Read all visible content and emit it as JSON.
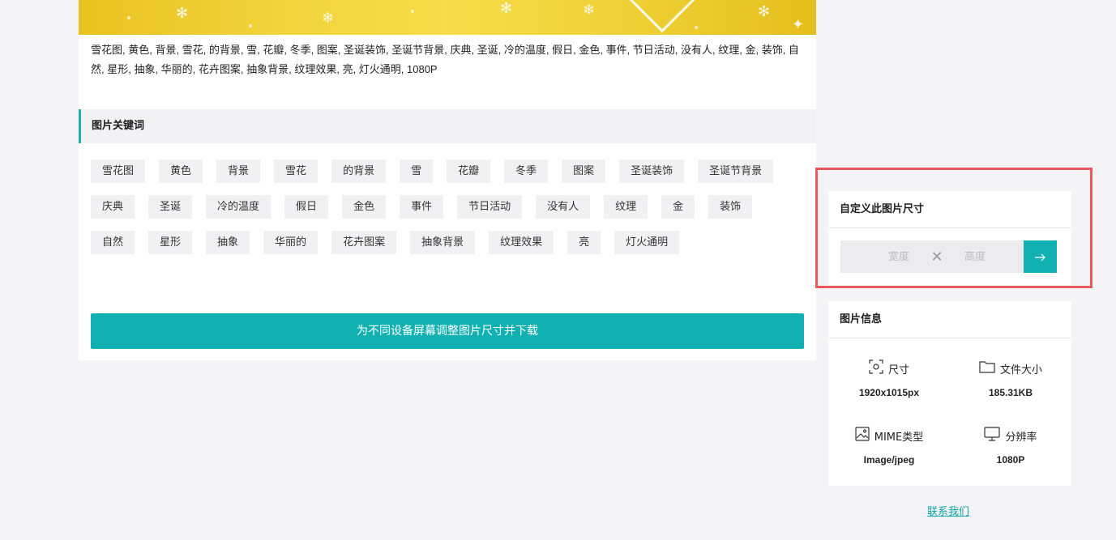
{
  "description": "雪花图, 黄色, 背景, 雪花, 的背景, 雪, 花瓣, 冬季, 图案, 圣诞装饰, 圣诞节背景, 庆典, 圣诞, 冷的温度, 假日, 金色, 事件, 节日活动, 没有人, 纹理, 金, 装饰, 自然, 星形, 抽象, 华丽的, 花卉图案, 抽象背景, 纹理效果, 亮, 灯火通明, 1080P",
  "keywords": {
    "title": "图片关键词",
    "tags": [
      "雪花图",
      "黄色",
      "背景",
      "雪花",
      "的背景",
      "雪",
      "花瓣",
      "冬季",
      "图案",
      "圣诞装饰",
      "圣诞节背景",
      "庆典",
      "圣诞",
      "冷的温度",
      "假日",
      "金色",
      "事件",
      "节日活动",
      "没有人",
      "纹理",
      "金",
      "装饰",
      "自然",
      "星形",
      "抽象",
      "华丽的",
      "花卉图案",
      "抽象背景",
      "纹理效果",
      "亮",
      "灯火通明"
    ]
  },
  "resize_button_label": "为不同设备屏幕调整图片尺寸并下载",
  "custom_size": {
    "title": "自定义此图片尺寸",
    "width_placeholder": "宽度",
    "height_placeholder": "高度"
  },
  "image_info": {
    "title": "图片信息",
    "size_label": "尺寸",
    "size_value": "1920x1015px",
    "filesize_label": "文件大小",
    "filesize_value": "185.31KB",
    "mime_label": "MIME类型",
    "mime_value": "Image/jpeg",
    "resolution_label": "分辨率",
    "resolution_value": "1080P"
  },
  "contact_label": "联系我们",
  "colors": {
    "accent": "#10b1b0",
    "highlight_frame": "#e8585c",
    "hero_gold": "#f1d23a"
  }
}
